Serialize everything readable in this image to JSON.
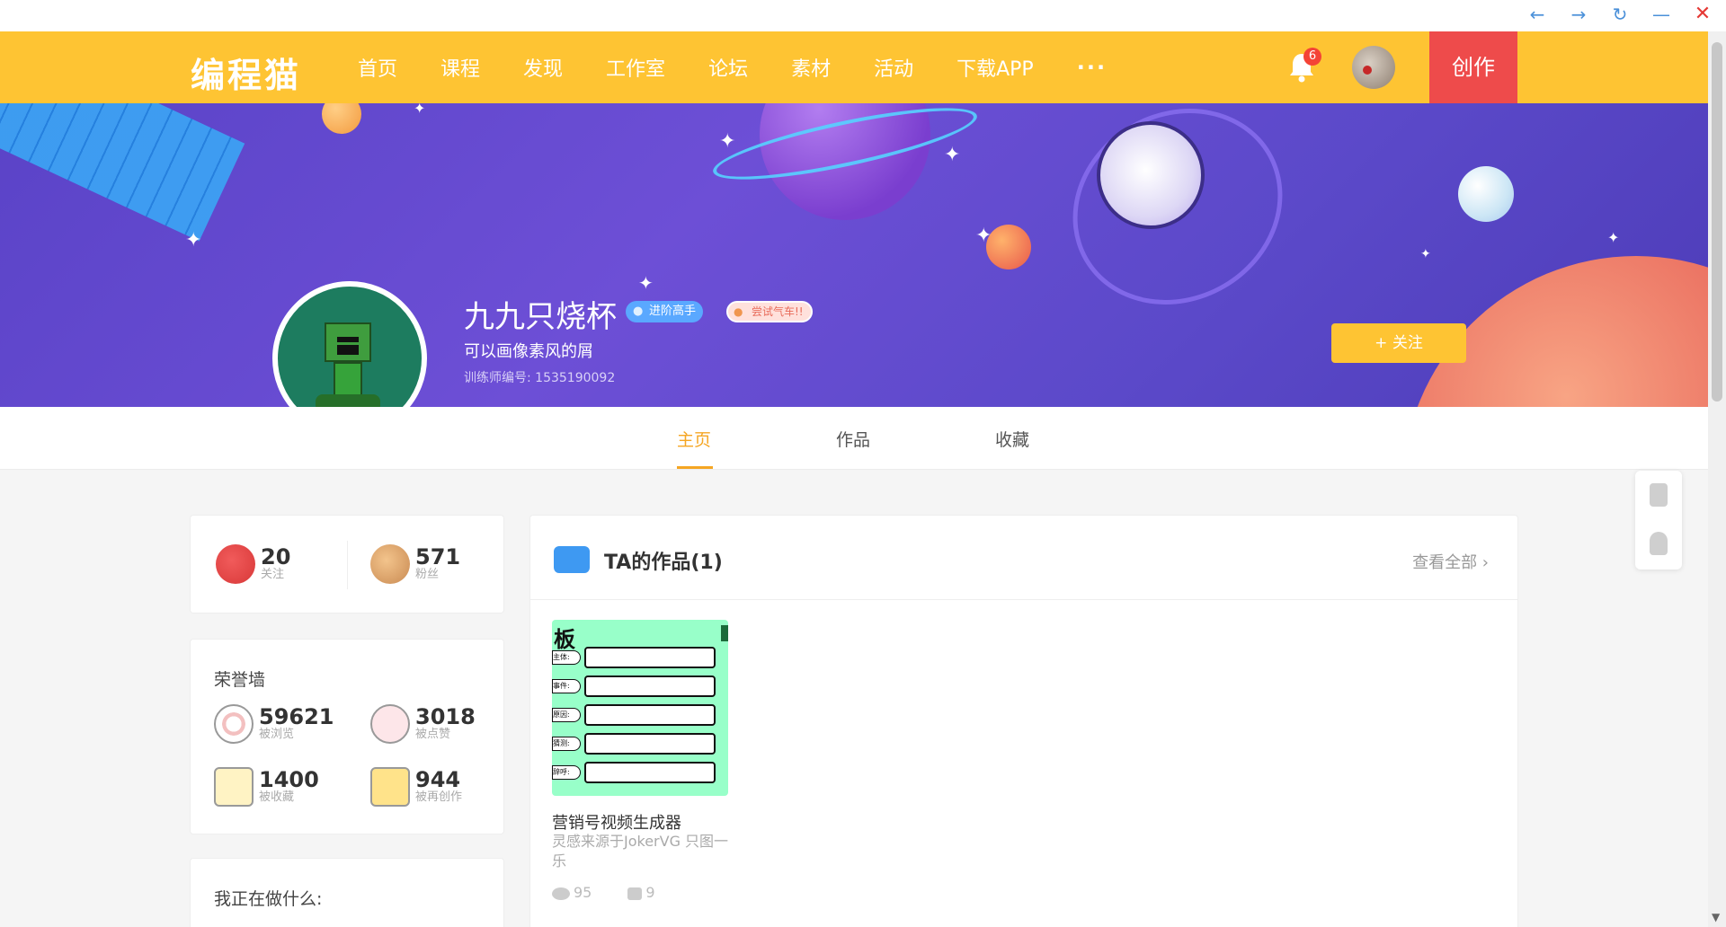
{
  "window": {
    "back": "←",
    "forward": "→",
    "refresh": "↻",
    "minimize": "—",
    "close": "✕"
  },
  "nav": {
    "logo": "编程猫",
    "items": [
      "首页",
      "课程",
      "发现",
      "工作室",
      "论坛",
      "素材",
      "活动",
      "下载APP"
    ],
    "more": "···",
    "notification_count": "6",
    "create_label": "创作"
  },
  "profile": {
    "name": "九九只烧杯",
    "badge_level": "进阶高手",
    "badge_popularity": "尝试气车!!",
    "bio": "可以画像素风的屑",
    "trainer_id": "训练师编号: 1535190092",
    "follow_label": "+ 关注"
  },
  "tabs": {
    "home": "主页",
    "works": "作品",
    "favorites": "收藏"
  },
  "follow_stats": {
    "following": {
      "value": "20",
      "label": "关注"
    },
    "fans": {
      "value": "571",
      "label": "粉丝"
    }
  },
  "honor": {
    "title": "荣誉墙",
    "views": {
      "value": "59621",
      "label": "被浏览"
    },
    "likes": {
      "value": "3018",
      "label": "被点赞"
    },
    "collects": {
      "value": "1400",
      "label": "被收藏"
    },
    "remixes": {
      "value": "944",
      "label": "被再创作"
    }
  },
  "doing": {
    "title": "我正在做什么:"
  },
  "works": {
    "title": "TA的作品(1)",
    "view_all": "查看全部 ›",
    "items": [
      {
        "name": "营销号视频生成器",
        "desc": "灵感来源于JokerVG 只图一乐",
        "views": "95",
        "likes": "9",
        "thumb": {
          "title": "板",
          "rows": [
            "主体:",
            "事件:",
            "原因:",
            "猜测:",
            "辞呼:"
          ]
        }
      }
    ]
  },
  "colors": {
    "brand": "#fec433",
    "create": "#ee4b4b",
    "tab_active": "#f5a623"
  }
}
